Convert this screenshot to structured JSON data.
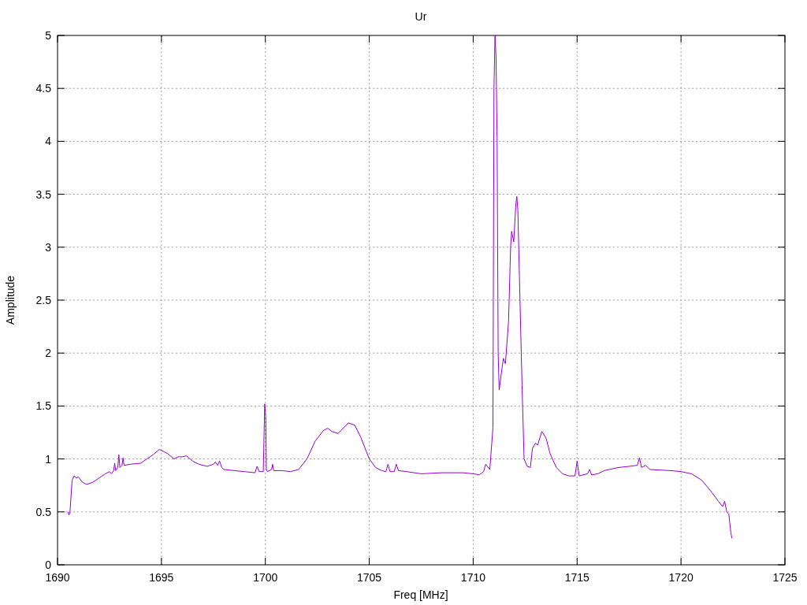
{
  "chart_data": {
    "type": "line",
    "grid": true,
    "title": "Ur",
    "xlabel": "Freq [MHz]",
    "ylabel": "Amplitude",
    "xlim": [
      1690,
      1725
    ],
    "ylim": [
      0,
      5
    ],
    "xticks": [
      1690,
      1695,
      1700,
      1705,
      1710,
      1715,
      1720,
      1725
    ],
    "yticks": [
      0,
      0.5,
      1,
      1.5,
      2,
      2.5,
      3,
      3.5,
      4,
      4.5,
      5
    ],
    "x": [
      1690.5,
      1690.55,
      1690.6,
      1690.7,
      1690.8,
      1690.9,
      1691.0,
      1691.2,
      1691.4,
      1691.7,
      1692.0,
      1692.3,
      1692.5,
      1692.6,
      1692.7,
      1692.75,
      1692.8,
      1692.9,
      1692.95,
      1693.0,
      1693.1,
      1693.15,
      1693.2,
      1693.5,
      1694.0,
      1694.3,
      1694.6,
      1694.9,
      1695.1,
      1695.3,
      1695.6,
      1695.8,
      1696.0,
      1696.2,
      1696.5,
      1696.8,
      1697.2,
      1697.5,
      1697.6,
      1697.7,
      1697.8,
      1697.9,
      1698.0,
      1698.5,
      1699.0,
      1699.5,
      1699.6,
      1699.7,
      1699.9,
      1699.97,
      1700.02,
      1700.05,
      1700.1,
      1700.3,
      1700.35,
      1700.4,
      1700.8,
      1701.2,
      1701.6,
      1702.0,
      1702.4,
      1702.8,
      1703.0,
      1703.2,
      1703.5,
      1703.8,
      1704.0,
      1704.3,
      1704.6,
      1705.0,
      1705.3,
      1705.6,
      1705.8,
      1705.9,
      1706.0,
      1706.2,
      1706.3,
      1706.4,
      1706.8,
      1707.5,
      1708.5,
      1709.5,
      1710.0,
      1710.3,
      1710.5,
      1710.6,
      1710.8,
      1710.95,
      1711.0,
      1711.05,
      1711.1,
      1711.15,
      1711.2,
      1711.25,
      1711.35,
      1711.45,
      1711.55,
      1711.7,
      1711.8,
      1711.85,
      1711.95,
      1712.05,
      1712.1,
      1712.15,
      1712.25,
      1712.35,
      1712.45,
      1712.6,
      1712.75,
      1712.85,
      1713.0,
      1713.1,
      1713.3,
      1713.5,
      1713.7,
      1714.0,
      1714.3,
      1714.6,
      1714.9,
      1715.0,
      1715.1,
      1715.5,
      1715.6,
      1715.7,
      1716.0,
      1716.3,
      1717.0,
      1717.5,
      1717.9,
      1718.0,
      1718.1,
      1718.3,
      1718.5,
      1719.5,
      1720.0,
      1720.5,
      1721.0,
      1721.5,
      1721.8,
      1722.0,
      1722.1,
      1722.2,
      1722.3,
      1722.4,
      1722.45
    ],
    "series": [
      {
        "color": "#9400d3",
        "values": [
          0.5,
          0.47,
          0.5,
          0.8,
          0.84,
          0.82,
          0.83,
          0.78,
          0.76,
          0.78,
          0.82,
          0.86,
          0.88,
          0.86,
          0.89,
          0.96,
          0.89,
          0.92,
          1.04,
          0.92,
          0.94,
          1.01,
          0.94,
          0.95,
          0.96,
          1.0,
          1.04,
          1.09,
          1.07,
          1.05,
          1.0,
          1.02,
          1.02,
          1.03,
          0.98,
          0.95,
          0.93,
          0.95,
          0.97,
          0.94,
          0.98,
          0.92,
          0.9,
          0.89,
          0.88,
          0.87,
          0.93,
          0.88,
          0.88,
          1.52,
          1.4,
          0.9,
          0.88,
          0.9,
          0.95,
          0.89,
          0.89,
          0.88,
          0.9,
          1.0,
          1.17,
          1.27,
          1.29,
          1.26,
          1.24,
          1.3,
          1.34,
          1.32,
          1.2,
          1.0,
          0.92,
          0.89,
          0.88,
          0.95,
          0.88,
          0.88,
          0.95,
          0.89,
          0.88,
          0.86,
          0.87,
          0.87,
          0.86,
          0.85,
          0.88,
          0.95,
          0.9,
          1.3,
          4.5,
          5.0,
          4.8,
          4.0,
          2.0,
          1.65,
          1.8,
          1.95,
          1.9,
          2.3,
          3.0,
          3.15,
          3.05,
          3.4,
          3.48,
          3.35,
          2.5,
          1.7,
          1.0,
          0.93,
          0.92,
          1.1,
          1.15,
          1.13,
          1.26,
          1.2,
          1.05,
          0.92,
          0.86,
          0.84,
          0.84,
          0.98,
          0.84,
          0.86,
          0.9,
          0.85,
          0.86,
          0.89,
          0.92,
          0.93,
          0.94,
          1.01,
          0.92,
          0.94,
          0.9,
          0.89,
          0.88,
          0.86,
          0.8,
          0.68,
          0.6,
          0.55,
          0.6,
          0.5,
          0.48,
          0.3,
          0.25
        ]
      }
    ]
  }
}
